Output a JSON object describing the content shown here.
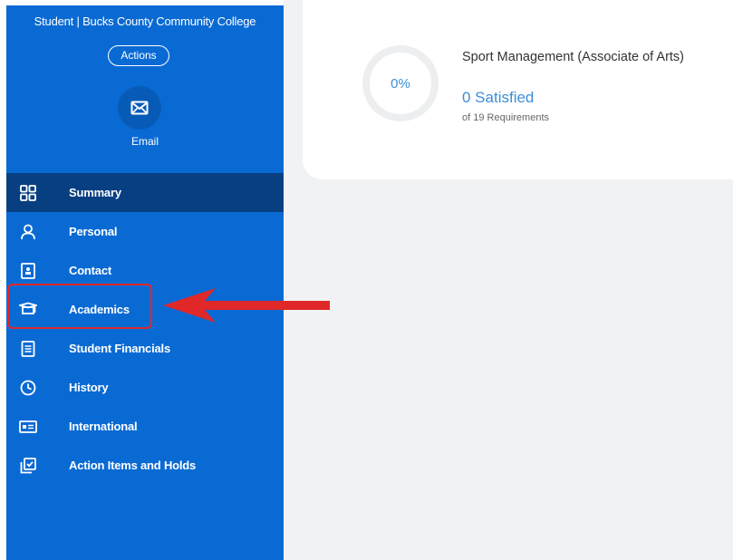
{
  "sidebar": {
    "title": "Student | Bucks County Community College",
    "actions_label": "Actions",
    "email_label": "Email",
    "items": [
      {
        "label": "Summary",
        "icon": "dashboard-icon",
        "active": true
      },
      {
        "label": "Personal",
        "icon": "person-icon"
      },
      {
        "label": "Contact",
        "icon": "contact-card-icon"
      },
      {
        "label": "Academics",
        "icon": "graduation-cap-icon",
        "highlighted": true
      },
      {
        "label": "Student Financials",
        "icon": "document-list-icon"
      },
      {
        "label": "History",
        "icon": "clock-icon"
      },
      {
        "label": "International",
        "icon": "id-card-icon"
      },
      {
        "label": "Action Items and Holds",
        "icon": "checkbox-stack-icon"
      }
    ]
  },
  "requirements_card": {
    "progress_text": "0%",
    "progress_fraction": 0,
    "program_name": "Sport Management (Associate of Arts)",
    "satisfied": "0 Satisfied",
    "requirements": "of 19 Requirements"
  },
  "colors": {
    "sidebar_bg": "#0a6ad4",
    "active_item_bg": "#083f80",
    "accent_blue": "#3d8ed6",
    "highlight_red": "#e02828"
  }
}
